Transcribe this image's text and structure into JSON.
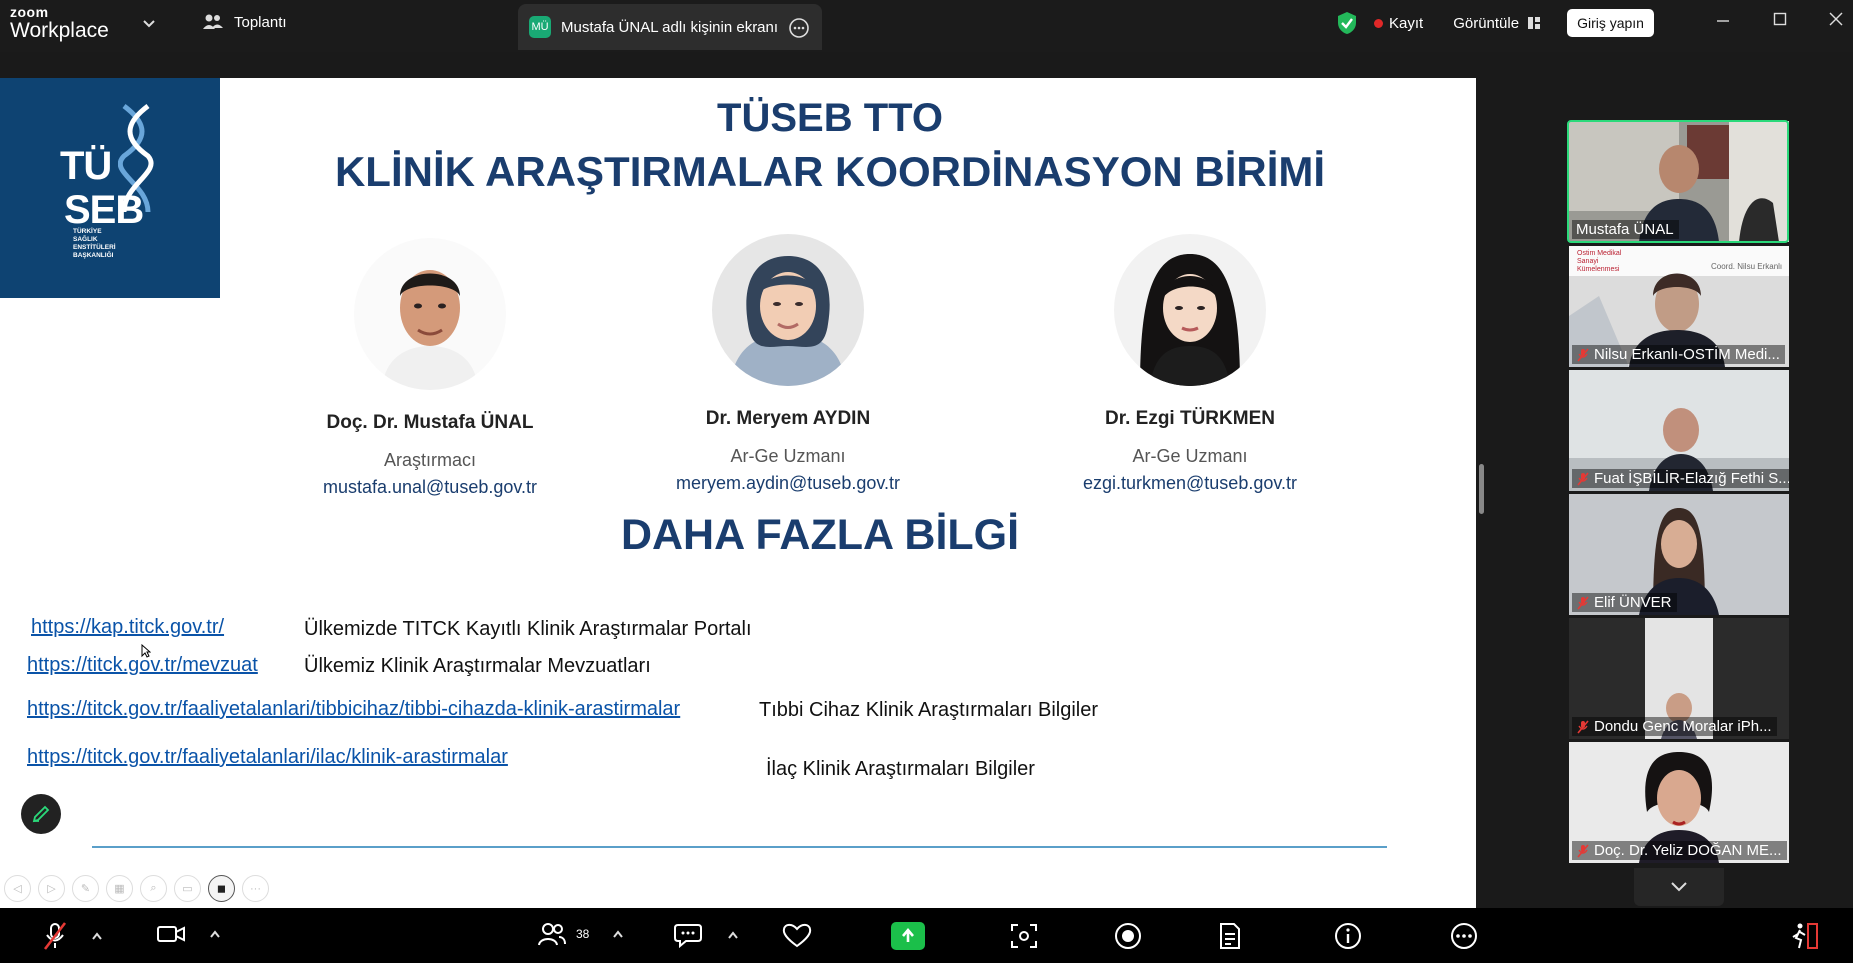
{
  "app": {
    "brand_top": "zoom",
    "brand_bottom": "Workplace"
  },
  "topbar": {
    "meeting_label": "Toplantı",
    "share_avatar": "MÜ",
    "share_label": "Mustafa ÜNAL adlı kişinin ekranı",
    "record_label": "Kayıt",
    "view_label": "Görüntüle",
    "signin_label": "Giriş yapın"
  },
  "slide": {
    "title1": "TÜSEB TTO",
    "title2": "KLİNİK ARAŞTIRMALAR KOORDİNASYON BİRİMİ",
    "logo": {
      "line1": "TÜ",
      "line2": "SEB",
      "sub": [
        "TÜRKİYE",
        "SAĞLIK",
        "ENSTİTÜLERİ",
        "BAŞKANLIĞI"
      ]
    },
    "people": [
      {
        "name": "Doç. Dr. Mustafa ÜNAL",
        "role": "Araştırmacı",
        "email": "mustafa.unal@tuseb.gov.tr"
      },
      {
        "name": "Dr. Meryem AYDIN",
        "role": "Ar-Ge Uzmanı",
        "email": "meryem.aydin@tuseb.gov.tr"
      },
      {
        "name": "Dr. Ezgi TÜRKMEN",
        "role": "Ar-Ge Uzmanı",
        "email": "ezgi.turkmen@tuseb.gov.tr"
      }
    ],
    "more_title": "DAHA FAZLA BİLGİ",
    "links": [
      {
        "url": "https://kap.titck.gov.tr/",
        "desc": "Ülkemizde TITCK Kayıtlı Klinik Araştırmalar Portalı"
      },
      {
        "url": "https://titck.gov.tr/mevzuat",
        "desc": "Ülkemiz Klinik Araştırmalar Mevzuatları"
      },
      {
        "url": "https://titck.gov.tr/faaliyetalanlari/tibbicihaz/tibbi-cihazda-klinik-arastirmalar",
        "desc": "Tıbbi Cihaz Klinik Araştırmaları Bilgiler"
      },
      {
        "url": "https://titck.gov.tr/faaliyetalanlari/ilac/klinik-arastirmalar",
        "desc": "İlaç Klinik Araştırmaları Bilgiler"
      }
    ]
  },
  "participants": [
    {
      "name": "Mustafa ÜNAL",
      "muted": false,
      "active": true
    },
    {
      "name": "Nilsu Erkanlı-OSTİM Medi...",
      "muted": true,
      "active": false,
      "overlay1": "Ostim Medikal Sanayi Kümelenmesi",
      "overlay2": "Coord. Nilsu Erkanlı"
    },
    {
      "name": "Fuat İŞBİLİR-Elazığ Fethi S...",
      "muted": true,
      "active": false
    },
    {
      "name": "Elif ÜNVER",
      "muted": true,
      "active": false
    },
    {
      "name": "Dondu Genc Moralar iPh...",
      "muted": true,
      "active": false
    },
    {
      "name": "Doç. Dr. Yeliz DOĞAN ME...",
      "muted": true,
      "active": false
    }
  ],
  "toolbar": {
    "participants_count": "38"
  },
  "colors": {
    "share_green": "#1bbf4a",
    "active_border": "#2bd97a",
    "slide_blue": "#1a3d6e",
    "logo_blue": "#0e4372"
  }
}
